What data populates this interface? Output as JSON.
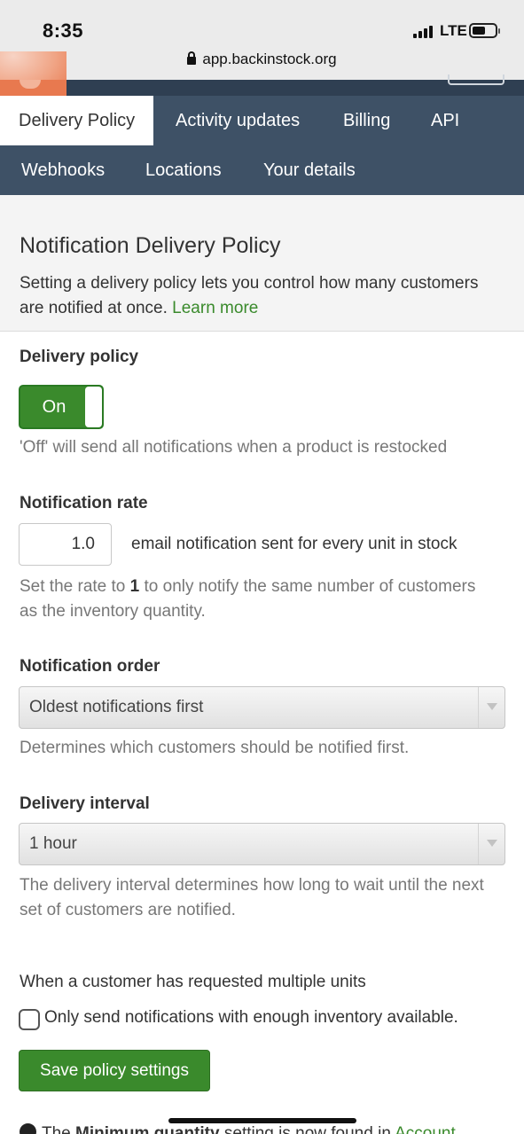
{
  "status_bar": {
    "time": "8:35",
    "network": "LTE"
  },
  "browser": {
    "url": "app.backinstock.org"
  },
  "tabs": [
    {
      "label": "Delivery Policy",
      "active": true
    },
    {
      "label": "Activity updates"
    },
    {
      "label": "Billing"
    },
    {
      "label": "API"
    },
    {
      "label": "Webhooks"
    },
    {
      "label": "Locations"
    },
    {
      "label": "Your details"
    }
  ],
  "intro": {
    "title": "Notification Delivery Policy",
    "description": "Setting a delivery policy lets you control how many customers are notified at once.",
    "learn_more": "Learn more"
  },
  "delivery_policy": {
    "label": "Delivery policy",
    "toggle_text": "On",
    "help": "'Off' will send all notifications when a product is restocked"
  },
  "notification_rate": {
    "label": "Notification rate",
    "value": "1.0",
    "suffix": "email notification sent for every unit in stock",
    "help_prefix": "Set the rate to",
    "help_bold": "1",
    "help_suffix": "to only notify the same number of customers as the inventory quantity."
  },
  "notification_order": {
    "label": "Notification order",
    "selected": "Oldest notifications first",
    "help": "Determines which customers should be notified first."
  },
  "delivery_interval": {
    "label": "Delivery interval",
    "selected": "1 hour",
    "help": "The delivery interval determines how long to wait until the next set of customers are notified."
  },
  "multiple_units": {
    "title": "When a customer has requested multiple units",
    "checkbox_label": "Only send notifications with enough inventory available.",
    "checked": false
  },
  "save_button": "Save policy settings",
  "footer_note": {
    "prefix": "The",
    "bold": "Minimum quantity",
    "middle": "setting is now found in",
    "link": "Account"
  },
  "colors": {
    "accent_green": "#3a8a2c",
    "nav_bg": "#3e5166",
    "brand_orange": "#e8794f"
  },
  "icons": {
    "lock": "lock-icon",
    "info": "info-icon",
    "dropdown": "chevron-down-icon"
  }
}
